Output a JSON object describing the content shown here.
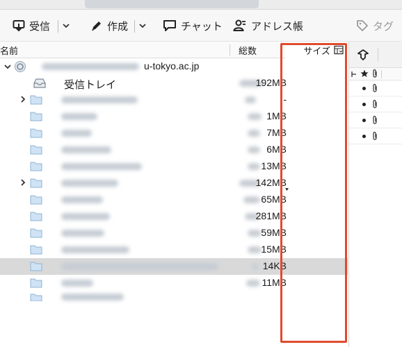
{
  "toolbar": {
    "get_messages_label": "受信",
    "write_label": "作成",
    "chat_label": "チャット",
    "address_book_label": "アドレス帳",
    "tag_label": "タグ"
  },
  "columns": {
    "name": "名前",
    "total": "総数",
    "size": "サイズ"
  },
  "account": {
    "host": "u-tokyo.ac.jp"
  },
  "folders": [
    {
      "label": "受信トレイ",
      "size": "192MB"
    },
    {
      "label": "",
      "size": "-"
    },
    {
      "label": "",
      "size": "1MB"
    },
    {
      "label": "",
      "size": "7MB"
    },
    {
      "label": "",
      "size": "6MB"
    },
    {
      "label": "",
      "size": "13MB"
    },
    {
      "label": "",
      "size": "142MB"
    },
    {
      "label": "",
      "size": "65MB"
    },
    {
      "label": "",
      "size": "281MB"
    },
    {
      "label": "",
      "size": "59MB"
    },
    {
      "label": "",
      "size": "15MB"
    },
    {
      "label": "",
      "size": "14KB"
    },
    {
      "label": "",
      "size": "11MB"
    }
  ],
  "colors": {
    "highlight_border": "#e04b2e",
    "selected_row": "#d9d9d9",
    "blur_bar": "#c5ccd4"
  },
  "icons": [
    "get-mail-icon",
    "pencil-icon",
    "chat-bubble-icon",
    "contacts-icon",
    "tag-icon",
    "column-picker-icon",
    "thread-icon",
    "star-icon",
    "attachment-icon",
    "folder-icon",
    "inbox-icon",
    "account-icon"
  ]
}
